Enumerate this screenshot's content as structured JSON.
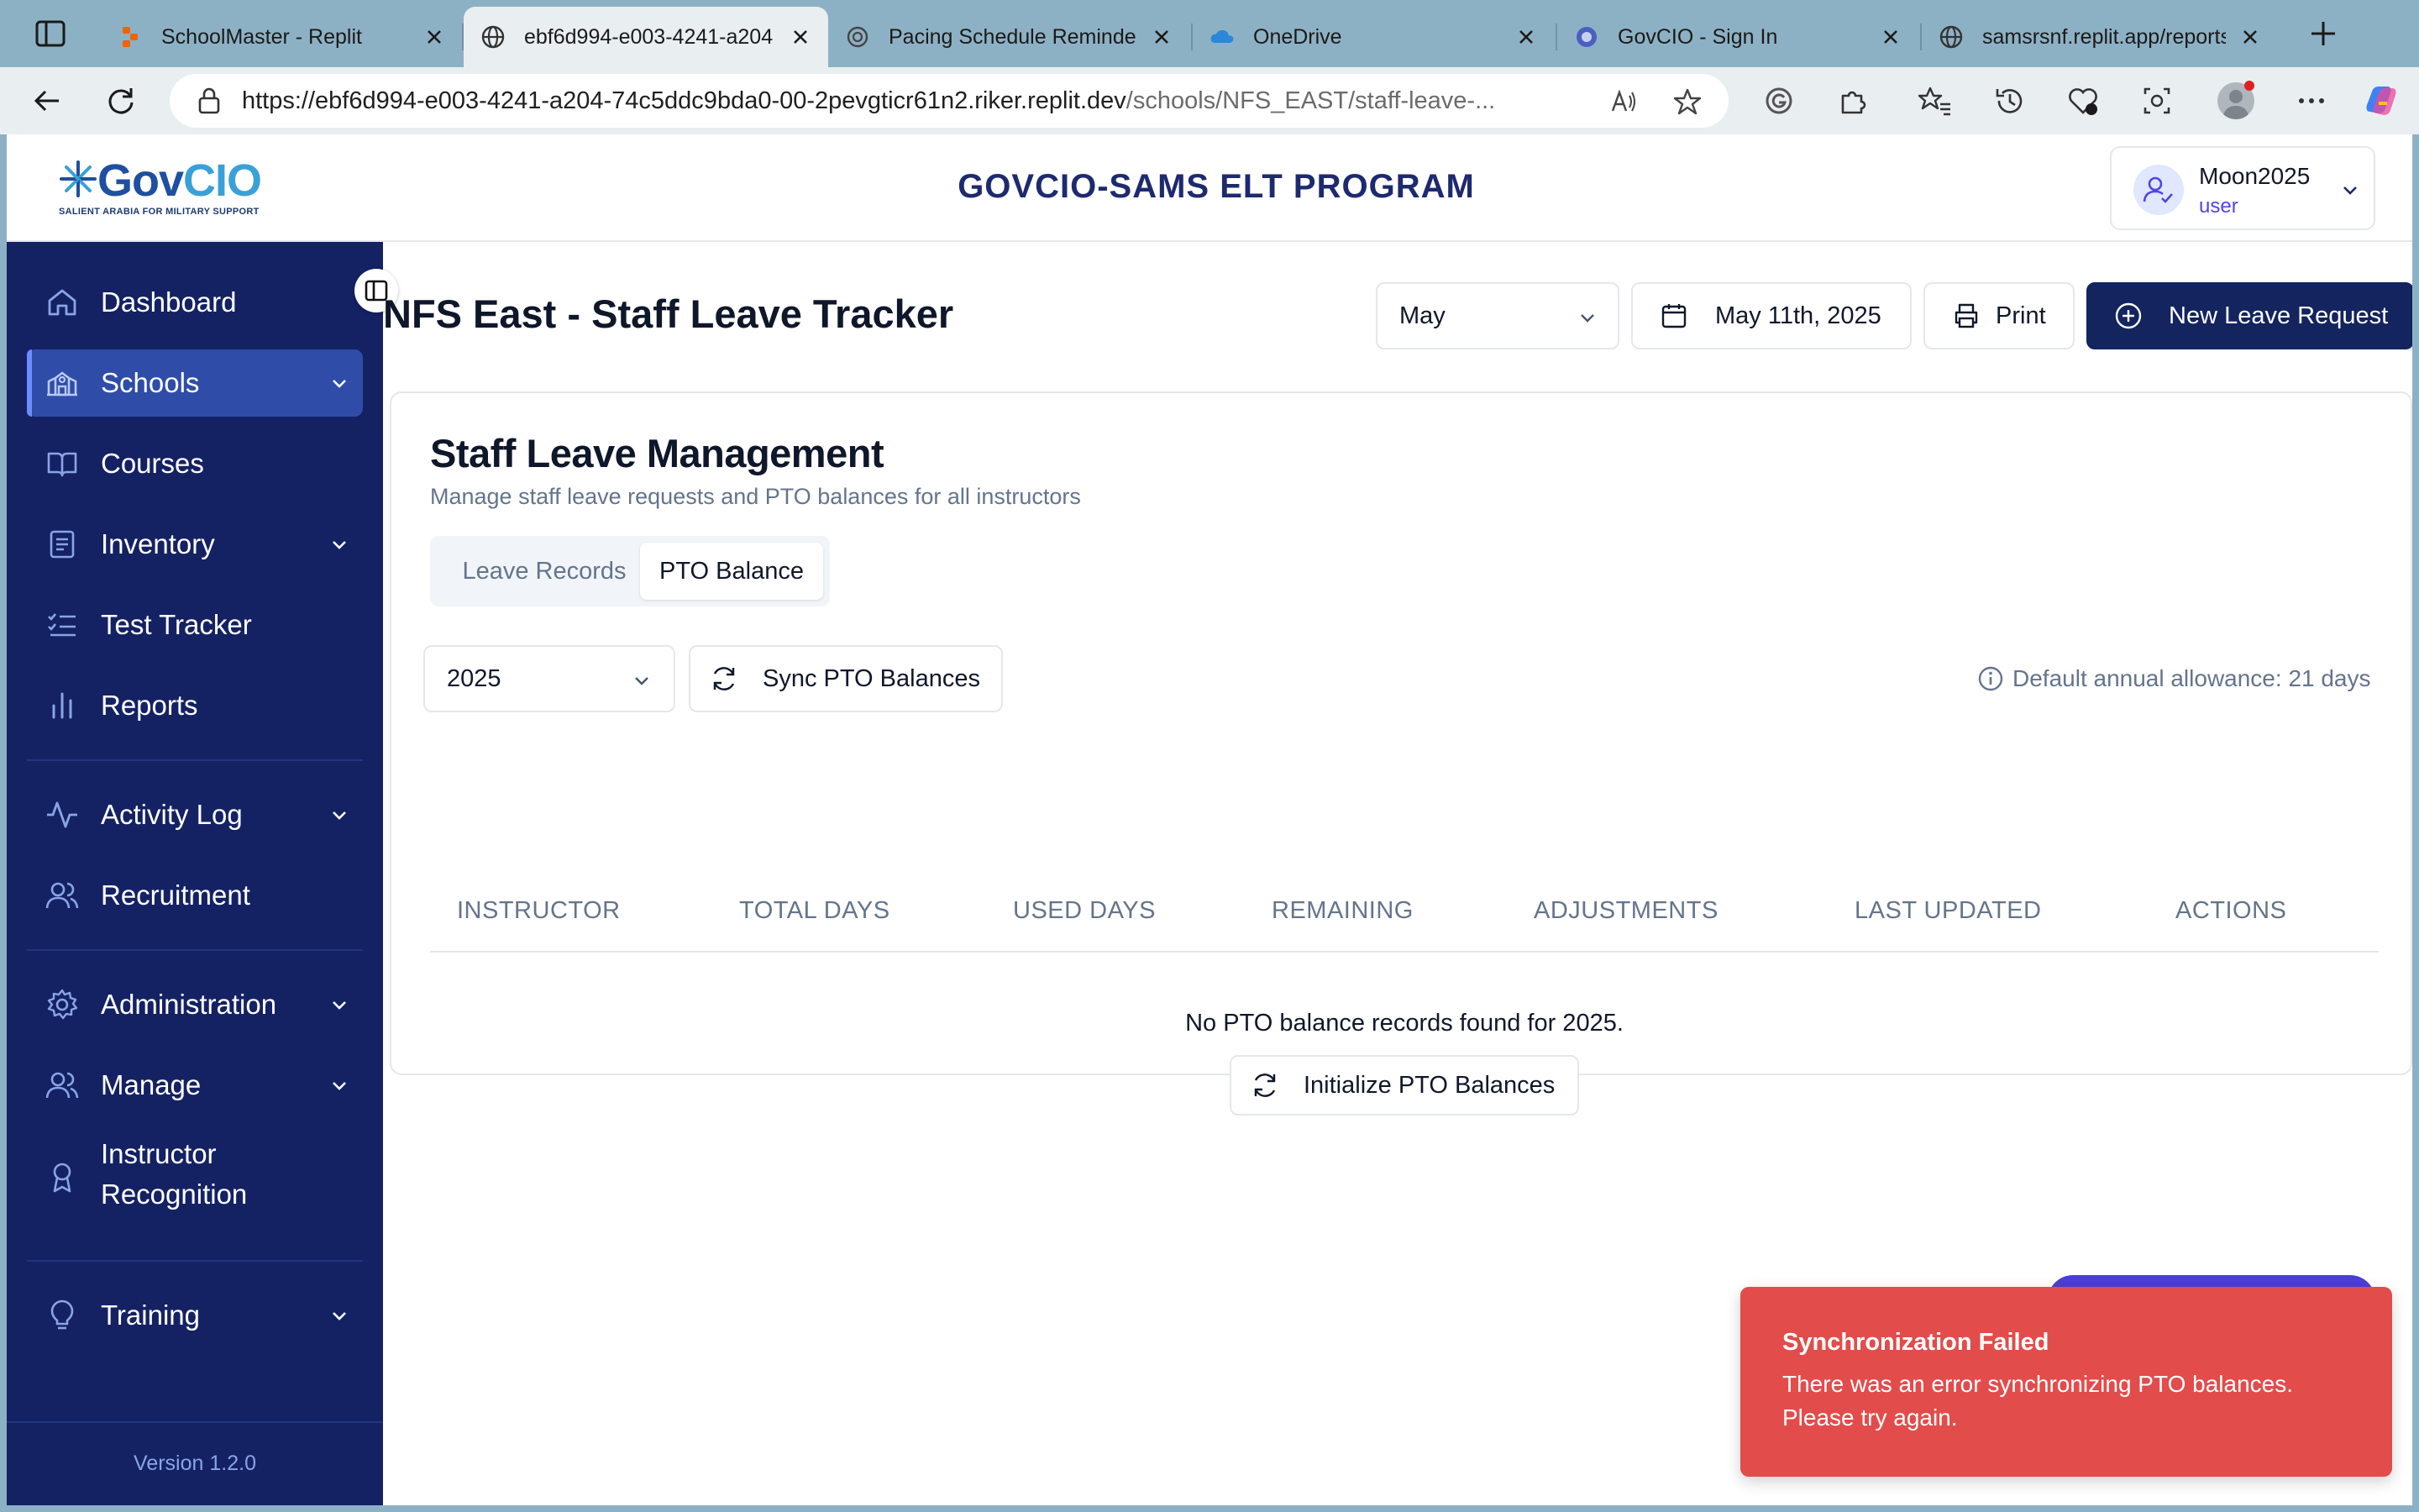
{
  "browser": {
    "tabs": [
      {
        "title": "SchoolMaster - Replit",
        "favicon": "replit-icon"
      },
      {
        "title": "ebf6d994-e003-4241-a204",
        "favicon": "globe-icon"
      },
      {
        "title": "Pacing Schedule Reminder",
        "favicon": "openai-icon"
      },
      {
        "title": "OneDrive",
        "favicon": "cloud-icon"
      },
      {
        "title": "GovCIO - Sign In",
        "favicon": "circle-icon"
      },
      {
        "title": "samsrsnf.replit.app/reports",
        "favicon": "globe-icon"
      }
    ],
    "url_main": "https://ebf6d994-e003-4241-a204-74c5ddc9bda0-00-2pevgticr61n2.riker.replit.dev",
    "url_path": "/schools/NFS_EAST/staff-leave-..."
  },
  "app": {
    "logo_text_a": "Gov",
    "logo_text_b": "CIO",
    "logo_tagline": "SALIENT ARABIA FOR MILITARY SUPPORT",
    "title": "GOVCIO-SAMS ELT PROGRAM",
    "user": {
      "name": "Moon2025",
      "role": "user"
    }
  },
  "sidebar": {
    "items": [
      {
        "label": "Dashboard",
        "icon": "home-icon"
      },
      {
        "label": "Schools",
        "icon": "school-icon",
        "active": true
      },
      {
        "label": "Courses",
        "icon": "book-open-icon"
      },
      {
        "label": "Inventory",
        "icon": "clipboard-icon"
      },
      {
        "label": "Test Tracker",
        "icon": "list-checks-icon"
      },
      {
        "label": "Reports",
        "icon": "bar-chart-icon"
      },
      {
        "label": "Activity Log",
        "icon": "activity-icon"
      },
      {
        "label": "Recruitment",
        "icon": "users-icon"
      },
      {
        "label": "Administration",
        "icon": "gear-icon"
      },
      {
        "label": "Manage",
        "icon": "users-icon"
      },
      {
        "label": "Instructor",
        "label2": "Recognition",
        "icon": "award-icon"
      },
      {
        "label": "Training",
        "icon": "lightbulb-icon"
      }
    ],
    "version": "Version 1.2.0"
  },
  "page": {
    "title": "NFS East - Staff Leave Tracker",
    "month_select": "May",
    "date_button": "May 11th, 2025",
    "print_button": "Print",
    "new_request_button": "New Leave Request"
  },
  "card": {
    "title": "Staff Leave Management",
    "subtitle": "Manage staff leave requests and PTO balances for all instructors",
    "tabs": [
      "Leave Records",
      "PTO Balance"
    ],
    "active_tab": "PTO Balance",
    "year_select": "2025",
    "sync_button": "Sync PTO Balances",
    "allowance_note": "Default annual allowance: 21 days",
    "columns": [
      "INSTRUCTOR",
      "TOTAL DAYS",
      "USED DAYS",
      "REMAINING",
      "ADJUSTMENTS",
      "LAST UPDATED",
      "ACTIONS"
    ],
    "empty_message": "No PTO balance records found for 2025.",
    "init_button": "Initialize PTO Balances"
  },
  "toast": {
    "title": "Synchronization Failed",
    "message": "There was an error synchronizing PTO balances. Please try again."
  },
  "colors": {
    "sidebar_bg": "#142264",
    "sidebar_active": "#2f4da8",
    "primary": "#13245f",
    "toast_bg": "#e24c4b",
    "browser_chrome": "#8db1c4"
  }
}
